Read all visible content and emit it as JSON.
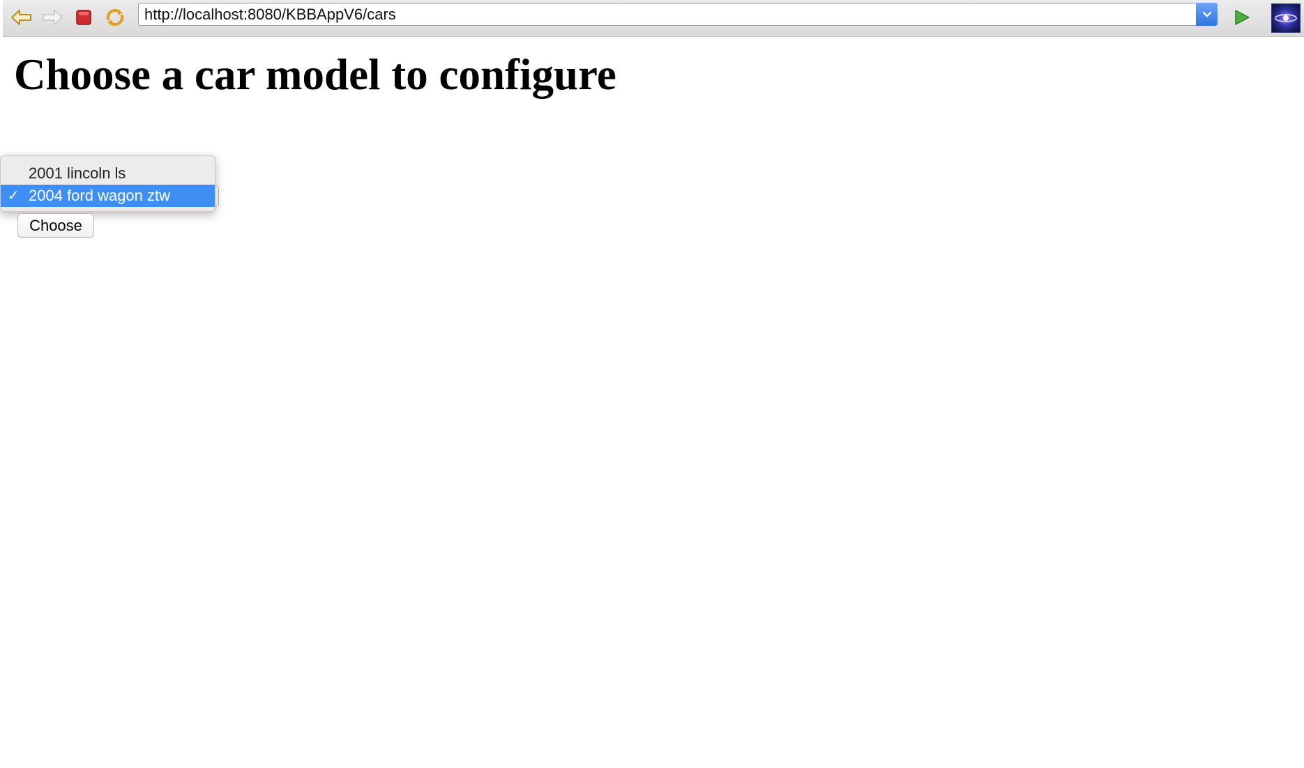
{
  "browser": {
    "url": "http://localhost:8080/KBBAppV6/cars",
    "icons": {
      "back": "back-arrow-icon",
      "forward": "forward-arrow-icon",
      "stop": "stop-icon",
      "reload": "reload-icon",
      "url_dropdown": "chevron-down-icon",
      "go": "play-triangle-icon",
      "logo": "browser-logo-icon"
    },
    "colors": {
      "accent": "#3f8ef3",
      "stop_red": "#d12b2b",
      "go_green": "#3aa53a",
      "arrow_gold": "#e0a020"
    }
  },
  "page": {
    "heading": "Choose a car model to configure",
    "select": {
      "options": [
        "2001 lincoln ls",
        "2004 ford wagon ztw"
      ],
      "selected_index": 1,
      "selected_value": "2004 ford wagon ztw",
      "checkmark": "✓"
    },
    "submit_label": "Choose"
  }
}
